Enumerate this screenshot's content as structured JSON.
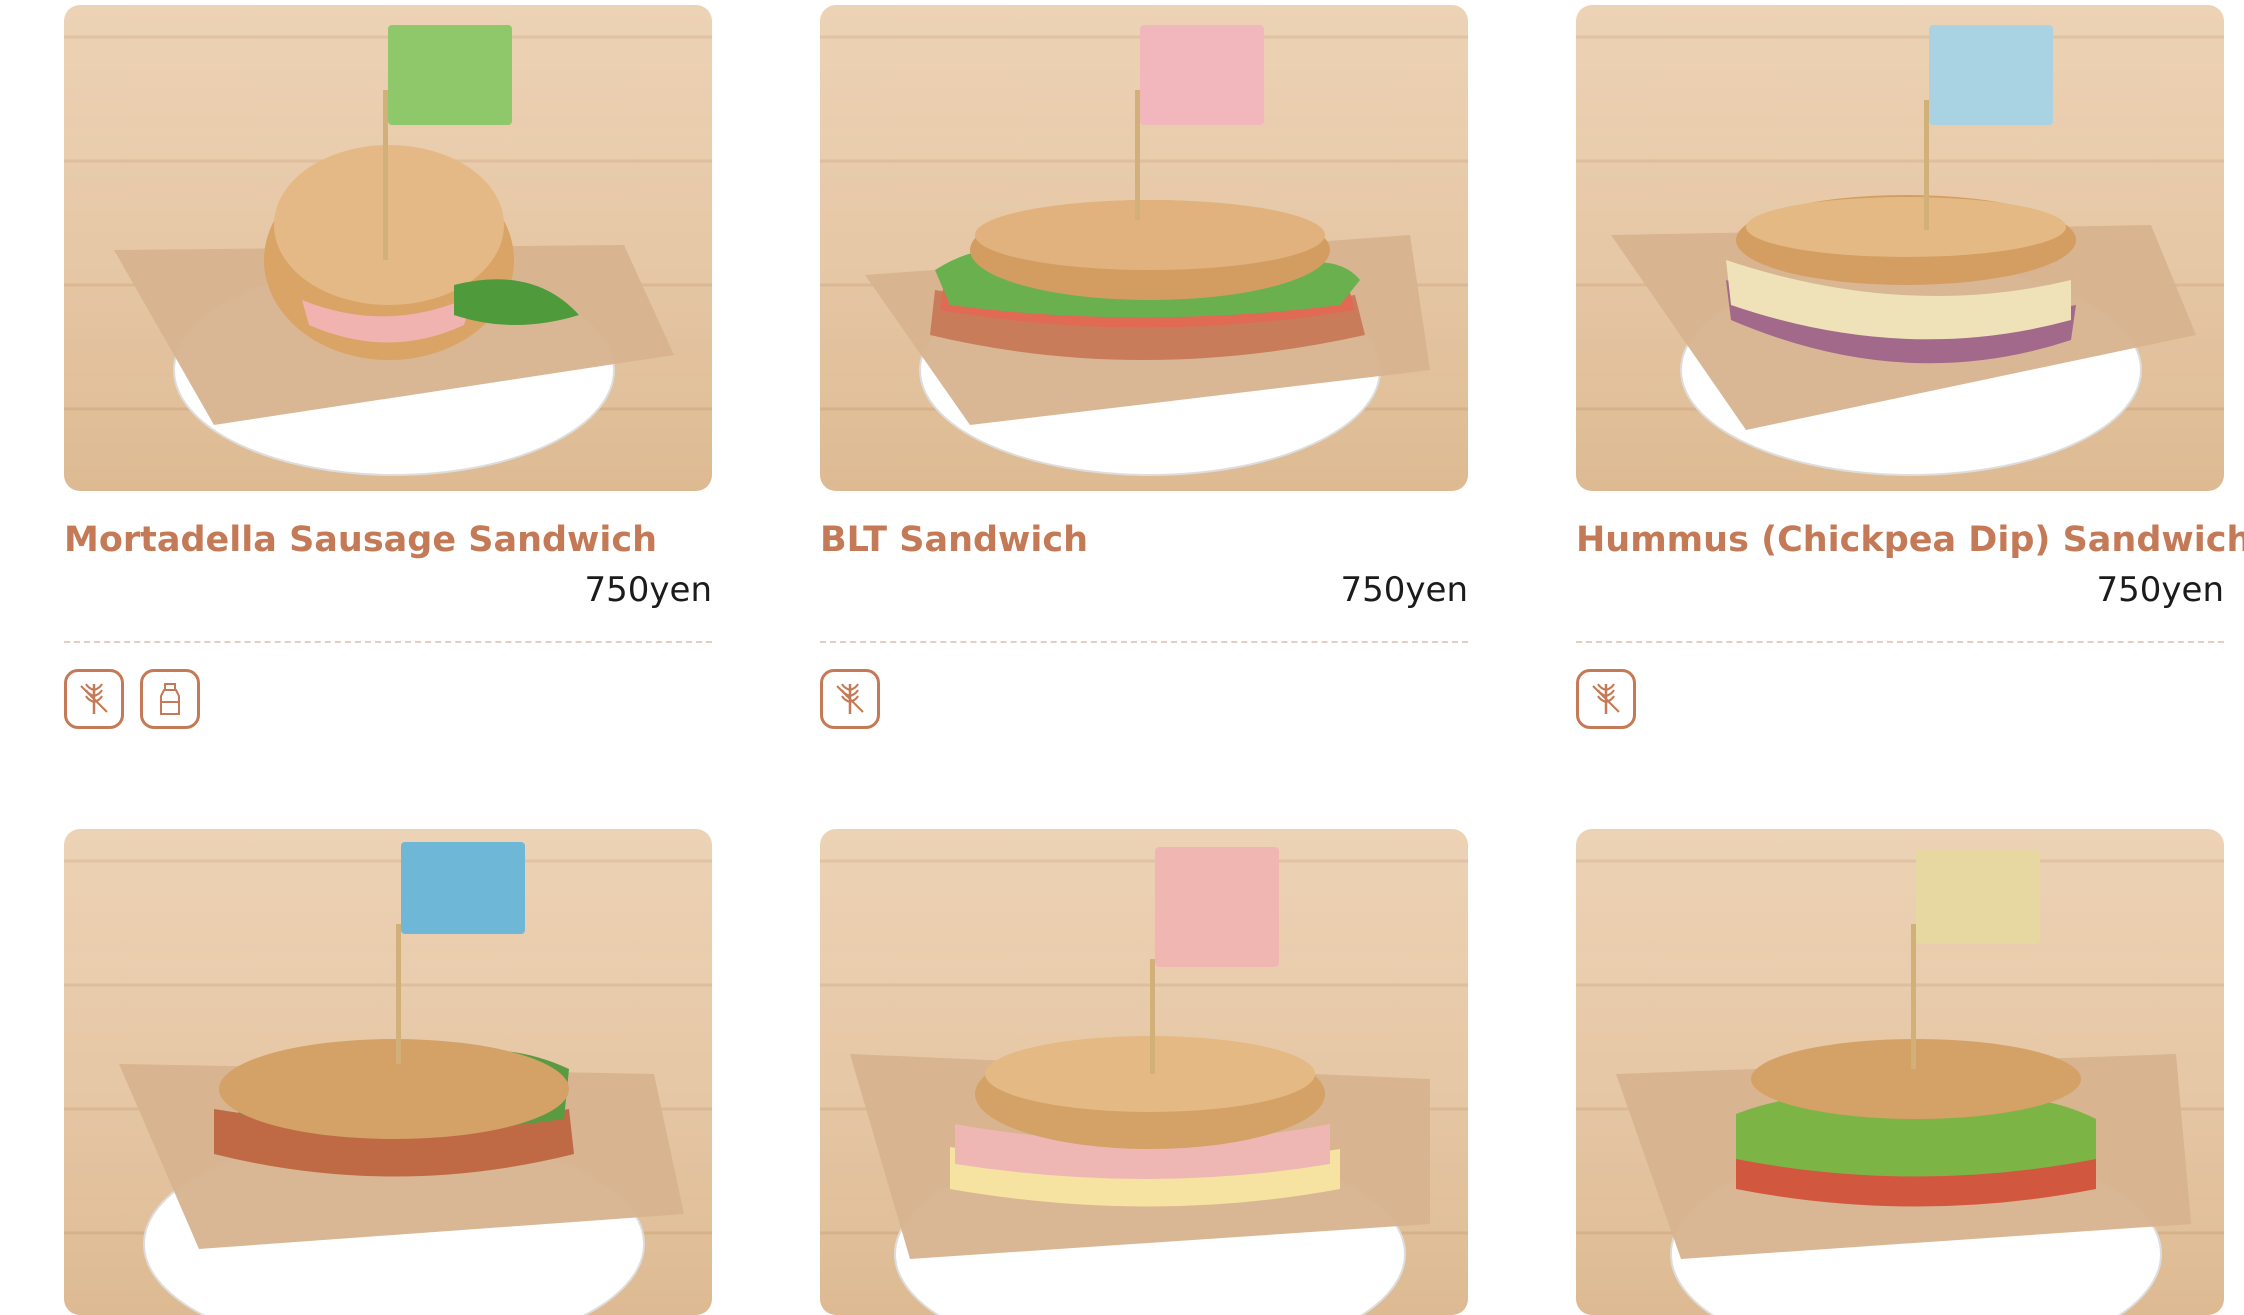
{
  "menu": {
    "items": [
      {
        "name": "Mortadella Sausage Sandwich",
        "price": "750yen",
        "allergens": [
          "wheat-icon",
          "milk-icon"
        ],
        "flag_color": "#8fc76b"
      },
      {
        "name": "BLT Sandwich",
        "price": "750yen",
        "allergens": [
          "wheat-icon"
        ],
        "flag_color": "#f2b7bd"
      },
      {
        "name": "Hummus (Chickpea Dip) Sandwich",
        "price": "750yen",
        "allergens": [
          "wheat-icon"
        ],
        "flag_color": "#a9d2e2"
      },
      {
        "flag_color": "#6fb7d6"
      },
      {
        "flag_color": "#f0b7b2"
      },
      {
        "flag_color": "#e7d8a2"
      }
    ]
  },
  "colors": {
    "accent": "#c47a56",
    "price_text": "#1b1b1b",
    "divider": "#e6cdbf"
  }
}
